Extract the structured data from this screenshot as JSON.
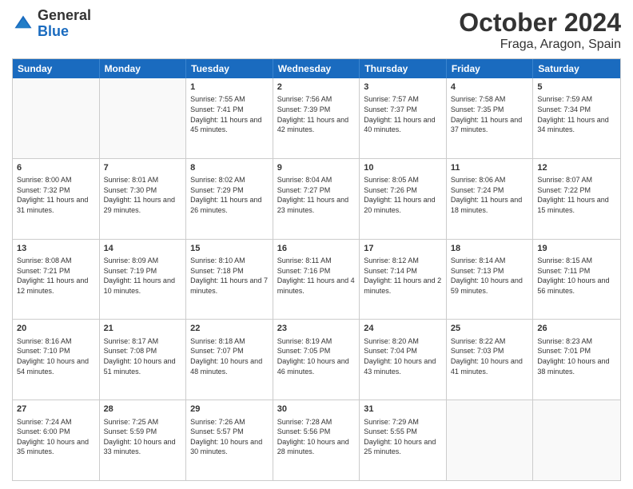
{
  "logo": {
    "general": "General",
    "blue": "Blue"
  },
  "title": "October 2024",
  "subtitle": "Fraga, Aragon, Spain",
  "days": [
    "Sunday",
    "Monday",
    "Tuesday",
    "Wednesday",
    "Thursday",
    "Friday",
    "Saturday"
  ],
  "weeks": [
    [
      {
        "day": "",
        "sunrise": "",
        "sunset": "",
        "daylight": ""
      },
      {
        "day": "",
        "sunrise": "",
        "sunset": "",
        "daylight": ""
      },
      {
        "day": "1",
        "sunrise": "Sunrise: 7:55 AM",
        "sunset": "Sunset: 7:41 PM",
        "daylight": "Daylight: 11 hours and 45 minutes."
      },
      {
        "day": "2",
        "sunrise": "Sunrise: 7:56 AM",
        "sunset": "Sunset: 7:39 PM",
        "daylight": "Daylight: 11 hours and 42 minutes."
      },
      {
        "day": "3",
        "sunrise": "Sunrise: 7:57 AM",
        "sunset": "Sunset: 7:37 PM",
        "daylight": "Daylight: 11 hours and 40 minutes."
      },
      {
        "day": "4",
        "sunrise": "Sunrise: 7:58 AM",
        "sunset": "Sunset: 7:35 PM",
        "daylight": "Daylight: 11 hours and 37 minutes."
      },
      {
        "day": "5",
        "sunrise": "Sunrise: 7:59 AM",
        "sunset": "Sunset: 7:34 PM",
        "daylight": "Daylight: 11 hours and 34 minutes."
      }
    ],
    [
      {
        "day": "6",
        "sunrise": "Sunrise: 8:00 AM",
        "sunset": "Sunset: 7:32 PM",
        "daylight": "Daylight: 11 hours and 31 minutes."
      },
      {
        "day": "7",
        "sunrise": "Sunrise: 8:01 AM",
        "sunset": "Sunset: 7:30 PM",
        "daylight": "Daylight: 11 hours and 29 minutes."
      },
      {
        "day": "8",
        "sunrise": "Sunrise: 8:02 AM",
        "sunset": "Sunset: 7:29 PM",
        "daylight": "Daylight: 11 hours and 26 minutes."
      },
      {
        "day": "9",
        "sunrise": "Sunrise: 8:04 AM",
        "sunset": "Sunset: 7:27 PM",
        "daylight": "Daylight: 11 hours and 23 minutes."
      },
      {
        "day": "10",
        "sunrise": "Sunrise: 8:05 AM",
        "sunset": "Sunset: 7:26 PM",
        "daylight": "Daylight: 11 hours and 20 minutes."
      },
      {
        "day": "11",
        "sunrise": "Sunrise: 8:06 AM",
        "sunset": "Sunset: 7:24 PM",
        "daylight": "Daylight: 11 hours and 18 minutes."
      },
      {
        "day": "12",
        "sunrise": "Sunrise: 8:07 AM",
        "sunset": "Sunset: 7:22 PM",
        "daylight": "Daylight: 11 hours and 15 minutes."
      }
    ],
    [
      {
        "day": "13",
        "sunrise": "Sunrise: 8:08 AM",
        "sunset": "Sunset: 7:21 PM",
        "daylight": "Daylight: 11 hours and 12 minutes."
      },
      {
        "day": "14",
        "sunrise": "Sunrise: 8:09 AM",
        "sunset": "Sunset: 7:19 PM",
        "daylight": "Daylight: 11 hours and 10 minutes."
      },
      {
        "day": "15",
        "sunrise": "Sunrise: 8:10 AM",
        "sunset": "Sunset: 7:18 PM",
        "daylight": "Daylight: 11 hours and 7 minutes."
      },
      {
        "day": "16",
        "sunrise": "Sunrise: 8:11 AM",
        "sunset": "Sunset: 7:16 PM",
        "daylight": "Daylight: 11 hours and 4 minutes."
      },
      {
        "day": "17",
        "sunrise": "Sunrise: 8:12 AM",
        "sunset": "Sunset: 7:14 PM",
        "daylight": "Daylight: 11 hours and 2 minutes."
      },
      {
        "day": "18",
        "sunrise": "Sunrise: 8:14 AM",
        "sunset": "Sunset: 7:13 PM",
        "daylight": "Daylight: 10 hours and 59 minutes."
      },
      {
        "day": "19",
        "sunrise": "Sunrise: 8:15 AM",
        "sunset": "Sunset: 7:11 PM",
        "daylight": "Daylight: 10 hours and 56 minutes."
      }
    ],
    [
      {
        "day": "20",
        "sunrise": "Sunrise: 8:16 AM",
        "sunset": "Sunset: 7:10 PM",
        "daylight": "Daylight: 10 hours and 54 minutes."
      },
      {
        "day": "21",
        "sunrise": "Sunrise: 8:17 AM",
        "sunset": "Sunset: 7:08 PM",
        "daylight": "Daylight: 10 hours and 51 minutes."
      },
      {
        "day": "22",
        "sunrise": "Sunrise: 8:18 AM",
        "sunset": "Sunset: 7:07 PM",
        "daylight": "Daylight: 10 hours and 48 minutes."
      },
      {
        "day": "23",
        "sunrise": "Sunrise: 8:19 AM",
        "sunset": "Sunset: 7:05 PM",
        "daylight": "Daylight: 10 hours and 46 minutes."
      },
      {
        "day": "24",
        "sunrise": "Sunrise: 8:20 AM",
        "sunset": "Sunset: 7:04 PM",
        "daylight": "Daylight: 10 hours and 43 minutes."
      },
      {
        "day": "25",
        "sunrise": "Sunrise: 8:22 AM",
        "sunset": "Sunset: 7:03 PM",
        "daylight": "Daylight: 10 hours and 41 minutes."
      },
      {
        "day": "26",
        "sunrise": "Sunrise: 8:23 AM",
        "sunset": "Sunset: 7:01 PM",
        "daylight": "Daylight: 10 hours and 38 minutes."
      }
    ],
    [
      {
        "day": "27",
        "sunrise": "Sunrise: 7:24 AM",
        "sunset": "Sunset: 6:00 PM",
        "daylight": "Daylight: 10 hours and 35 minutes."
      },
      {
        "day": "28",
        "sunrise": "Sunrise: 7:25 AM",
        "sunset": "Sunset: 5:59 PM",
        "daylight": "Daylight: 10 hours and 33 minutes."
      },
      {
        "day": "29",
        "sunrise": "Sunrise: 7:26 AM",
        "sunset": "Sunset: 5:57 PM",
        "daylight": "Daylight: 10 hours and 30 minutes."
      },
      {
        "day": "30",
        "sunrise": "Sunrise: 7:28 AM",
        "sunset": "Sunset: 5:56 PM",
        "daylight": "Daylight: 10 hours and 28 minutes."
      },
      {
        "day": "31",
        "sunrise": "Sunrise: 7:29 AM",
        "sunset": "Sunset: 5:55 PM",
        "daylight": "Daylight: 10 hours and 25 minutes."
      },
      {
        "day": "",
        "sunrise": "",
        "sunset": "",
        "daylight": ""
      },
      {
        "day": "",
        "sunrise": "",
        "sunset": "",
        "daylight": ""
      }
    ]
  ]
}
